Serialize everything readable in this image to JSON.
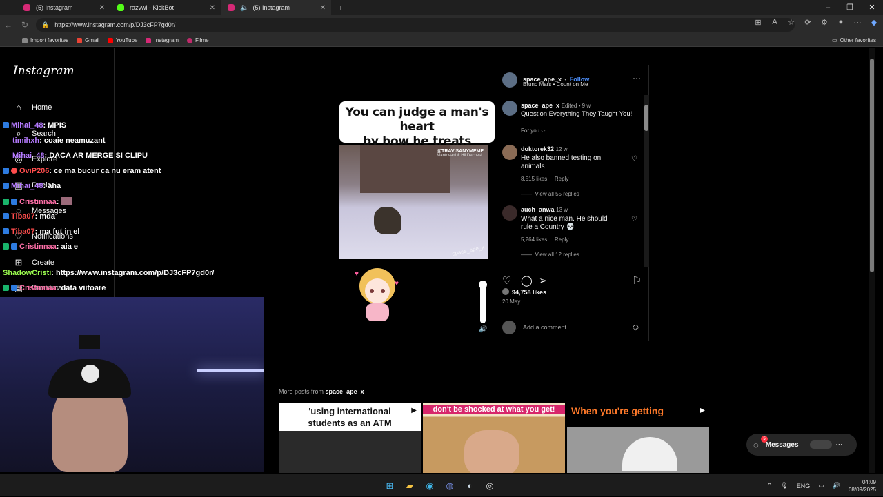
{
  "browser": {
    "tabs": [
      {
        "label": "(5) Instagram",
        "color": "#d62976"
      },
      {
        "label": "razvwi - KickBot",
        "color": "#53fc18"
      },
      {
        "label": "(5) Instagram",
        "color": "#d62976"
      }
    ],
    "url": "https://www.instagram.com/p/DJ3cFP7gd0r/",
    "favorites": [
      {
        "label": "Import favorites",
        "color": "#888888"
      },
      {
        "label": "Gmail",
        "color": "#ea4335"
      },
      {
        "label": "YouTube",
        "color": "#ff0000"
      },
      {
        "label": "Instagram",
        "color": "#d62976"
      },
      {
        "label": "Filme",
        "color": "#c02a6b"
      }
    ],
    "other_favorites": "Other favorites"
  },
  "sidebar": {
    "logo": "Instagram",
    "items": [
      {
        "label": "Home",
        "icon": "home-icon"
      },
      {
        "label": "Search",
        "icon": "search-icon"
      },
      {
        "label": "Explore",
        "icon": "compass-icon"
      },
      {
        "label": "Reels",
        "icon": "reels-icon"
      },
      {
        "label": "Messages",
        "icon": "messenger-icon"
      },
      {
        "label": "Notifications",
        "icon": "heart-icon"
      },
      {
        "label": "Create",
        "icon": "plus-icon"
      },
      {
        "label": "Dashboard",
        "icon": "dashboard-icon"
      }
    ]
  },
  "post": {
    "caption_line1": "You can judge a man's heart",
    "caption_line2": "by how he treats animals",
    "watermark": "@TRAVISANYMEME",
    "watermark_sub": "Mantovani & Hii Dechesi",
    "watermark_rotated": "space_ape_x",
    "author": "space_ape_x",
    "dot": "•",
    "follow": "Follow",
    "audio": "Bruno Mars • Count on Me",
    "caption_user": "space_ape_x",
    "caption_meta": "Edited • 9 w",
    "caption_text": "Question Everything They Taught You!",
    "for_you": "For you",
    "comments": [
      {
        "user": "doktorek32",
        "time": "12 w",
        "text1": "He also banned testing on",
        "text2": "animals",
        "likes": "8,515 likes",
        "reply": "Reply",
        "replies": "View all 55 replies"
      },
      {
        "user": "auch_anwa",
        "time": "13 w",
        "text1": "What a nice man. He should",
        "text2": "rule a Country 💀",
        "likes": "5,264 likes",
        "reply": "Reply",
        "replies": "View all 12 replies"
      }
    ],
    "likes": "94,758 likes",
    "date": "20 May",
    "add_comment": "Add a comment..."
  },
  "more": {
    "label": "More posts from",
    "user": "space_ape_x",
    "thumbs": [
      {
        "text": "'using international students as an ATM",
        "reel": "reel-icon"
      },
      {
        "text": "don't be shocked at what you get!",
        "reel": ""
      },
      {
        "text": "When you're getting",
        "reel": "reel-icon"
      }
    ]
  },
  "messages": {
    "label": "Messages",
    "badge": "5"
  },
  "chat": [
    {
      "user": "Mihai_48",
      "msg": "MPIS",
      "color": "#b57bff",
      "badge": "#2d7be0"
    },
    {
      "user": "timihxh",
      "msg": "coaie neamuzant",
      "color": "#b57bff",
      "badge": ""
    },
    {
      "user": "Mihai_48",
      "msg": "DACA AR MERGE SI CLIPU",
      "color": "#b57bff",
      "badge": ""
    },
    {
      "user": "OviP206",
      "msg": "ce ma bucur ca nu eram atent",
      "color": "#ff4d4d",
      "badge": "#2d7be0"
    },
    {
      "user": "Mihai_48",
      "msg": "aha",
      "color": "#b57bff",
      "badge": "#2d7be0"
    },
    {
      "user": "Cristinnaa",
      "msg": "",
      "color": "#ff6fa8",
      "badge": "#19b46b"
    },
    {
      "user": "Tiba07",
      "msg": "mda",
      "color": "#ff4d4d",
      "badge": "#2d7be0"
    },
    {
      "user": "Tiba07",
      "msg": "ma fut in el",
      "color": "#ff4d4d",
      "badge": "#2d7be0"
    },
    {
      "user": "Cristinnaa",
      "msg": "aia e",
      "color": "#ff6fa8",
      "badge": "#19b46b"
    },
    {
      "user": "ShadowCristi",
      "msg": "https://www.instagram.com/p/DJ3cFP7gd0r/",
      "color": "#9dff4f",
      "badge": ""
    },
    {
      "user": "Cristinnaa",
      "msg": "data viitoare",
      "color": "#ff6fa8",
      "badge": "#19b46b"
    }
  ],
  "taskbar": {
    "lang": "ENG",
    "time": "04:09",
    "date": "08/09/2025"
  }
}
